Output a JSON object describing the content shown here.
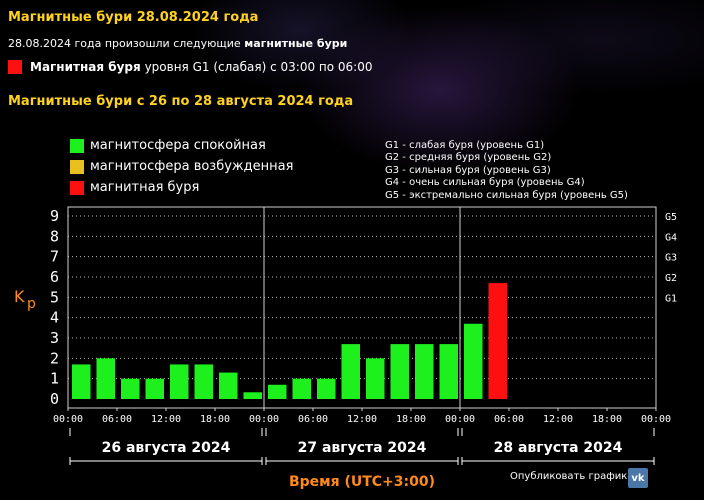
{
  "page": {
    "title": "Магнитные бури 28.08.2024 года",
    "intro_text": "28.08.2024 года произошли следующие",
    "intro_bold": "магнитные бури",
    "event_label_bold": "Магнитная буря",
    "event_label_text": "уровня G1 (слабая) с 03:00 по 06:00",
    "section_title": "Магнитные бури с 26 по 28 августа 2024 года",
    "share_label": "Опубликовать график:",
    "vk_icon": "vk-icon"
  },
  "colors": {
    "calm": "#1ef01e",
    "excited": "#e8c020",
    "storm": "#ff1010",
    "heading": "#ffd21f",
    "axis_label": "#ff8a1a"
  },
  "legend": [
    {
      "label": "магнитосфера спокойная",
      "color": "#1ef01e"
    },
    {
      "label": "магнитосфера возбужденная",
      "color": "#e8c020"
    },
    {
      "label": "магнитная буря",
      "color": "#ff1010"
    }
  ],
  "g_levels": [
    "G1 - слабая буря (уровень G1)",
    "G2 - средняя буря (уровень G2)",
    "G3 - сильная буря (уровень G3)",
    "G4 - очень сильная буря (уровень G4)",
    "G5 - экстремально сильная буря (уровень G5)"
  ],
  "chart_data": {
    "type": "bar",
    "ylabel": "Kp",
    "xlabel": "Время (UTC+3:00)",
    "ylim": [
      0,
      9
    ],
    "yticks": [
      "0",
      "1",
      "2",
      "3",
      "4",
      "5",
      "6",
      "7",
      "8",
      "9"
    ],
    "right_ticks": [
      {
        "value": 5,
        "label": "G1"
      },
      {
        "value": 6,
        "label": "G2"
      },
      {
        "value": 7,
        "label": "G3"
      },
      {
        "value": 8,
        "label": "G4"
      },
      {
        "value": 9,
        "label": "G5"
      }
    ],
    "day_labels": [
      "26 августа 2024",
      "27 августа 2024",
      "28 августа 2024"
    ],
    "x_ticks": [
      "00:00",
      "06:00",
      "12:00",
      "18:00",
      "00:00",
      "06:00",
      "12:00",
      "18:00",
      "00:00",
      "06:00",
      "12:00",
      "18:00",
      "00:00"
    ],
    "categories": [
      "26.08 00:00",
      "26.08 03:00",
      "26.08 06:00",
      "26.08 09:00",
      "26.08 12:00",
      "26.08 15:00",
      "26.08 18:00",
      "26.08 21:00",
      "27.08 00:00",
      "27.08 03:00",
      "27.08 06:00",
      "27.08 09:00",
      "27.08 12:00",
      "27.08 15:00",
      "27.08 18:00",
      "27.08 21:00",
      "28.08 00:00",
      "28.08 03:00"
    ],
    "values": [
      1.7,
      2.0,
      1.0,
      1.0,
      1.7,
      1.7,
      1.3,
      0.33,
      0.7,
      1.0,
      1.0,
      2.7,
      2.0,
      2.7,
      2.7,
      2.7,
      3.7,
      5.7
    ],
    "bar_status": [
      "calm",
      "calm",
      "calm",
      "calm",
      "calm",
      "calm",
      "calm",
      "calm",
      "calm",
      "calm",
      "calm",
      "calm",
      "calm",
      "calm",
      "calm",
      "calm",
      "calm",
      "storm"
    ],
    "grid": true
  }
}
